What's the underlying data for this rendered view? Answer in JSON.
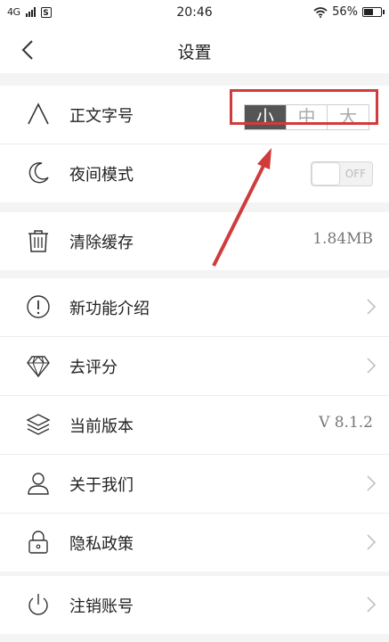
{
  "status_bar": {
    "network": "4G",
    "time": "20:46",
    "battery": "56%",
    "battery_level": 0.56
  },
  "header": {
    "title": "设置"
  },
  "font_size": {
    "label": "正文字号",
    "options": [
      "小",
      "中",
      "大"
    ],
    "selected": "小"
  },
  "night_mode": {
    "label": "夜间模式",
    "toggle_text": "OFF"
  },
  "cache": {
    "label": "清除缓存",
    "value": "1.84MB"
  },
  "menu": {
    "features": "新功能介绍",
    "rate": "去评分",
    "version_label": "当前版本",
    "version_value": "V 8.1.2",
    "about": "关于我们",
    "privacy": "隐私政策"
  },
  "account": {
    "logout": "注销账号"
  },
  "colors": {
    "annotation": "#d03b3b",
    "selected_segment": "#555555"
  },
  "icons": {
    "back": "chevron-left-icon",
    "font": "letter-a-icon",
    "night": "moon-icon",
    "cache": "trash-icon",
    "features": "info-circle-icon",
    "rate": "diamond-icon",
    "version": "layers-icon",
    "about": "user-icon",
    "privacy": "lock-icon",
    "logout": "power-icon"
  }
}
